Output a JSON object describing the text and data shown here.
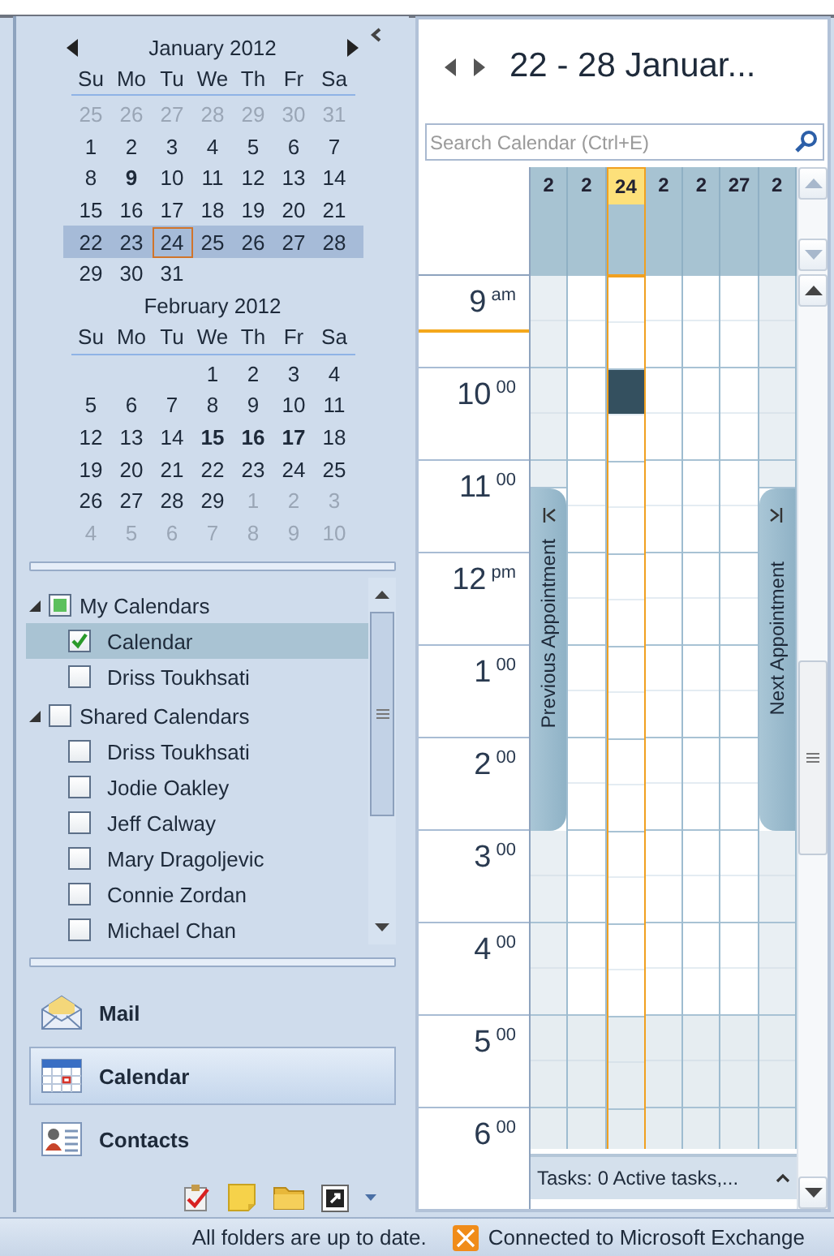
{
  "months": [
    {
      "title": "January 2012",
      "weekdays": [
        "Su",
        "Mo",
        "Tu",
        "We",
        "Th",
        "Fr",
        "Sa"
      ],
      "weeks": [
        {
          "selected": false,
          "days": [
            {
              "text": "25",
              "kind": "other"
            },
            {
              "text": "26",
              "kind": "other"
            },
            {
              "text": "27",
              "kind": "other"
            },
            {
              "text": "28",
              "kind": "other"
            },
            {
              "text": "29",
              "kind": "other"
            },
            {
              "text": "30",
              "kind": "other"
            },
            {
              "text": "31",
              "kind": "other"
            }
          ]
        },
        {
          "selected": false,
          "days": [
            {
              "text": "1",
              "kind": "day"
            },
            {
              "text": "2",
              "kind": "day"
            },
            {
              "text": "3",
              "kind": "day"
            },
            {
              "text": "4",
              "kind": "day"
            },
            {
              "text": "5",
              "kind": "day"
            },
            {
              "text": "6",
              "kind": "day"
            },
            {
              "text": "7",
              "kind": "day"
            }
          ]
        },
        {
          "selected": false,
          "days": [
            {
              "text": "8",
              "kind": "day"
            },
            {
              "text": "9",
              "kind": "busy"
            },
            {
              "text": "10",
              "kind": "day"
            },
            {
              "text": "11",
              "kind": "day"
            },
            {
              "text": "12",
              "kind": "day"
            },
            {
              "text": "13",
              "kind": "day"
            },
            {
              "text": "14",
              "kind": "day"
            }
          ]
        },
        {
          "selected": false,
          "days": [
            {
              "text": "15",
              "kind": "day"
            },
            {
              "text": "16",
              "kind": "day"
            },
            {
              "text": "17",
              "kind": "day"
            },
            {
              "text": "18",
              "kind": "day"
            },
            {
              "text": "19",
              "kind": "day"
            },
            {
              "text": "20",
              "kind": "day"
            },
            {
              "text": "21",
              "kind": "day"
            }
          ]
        },
        {
          "selected": true,
          "days": [
            {
              "text": "22",
              "kind": "day"
            },
            {
              "text": "23",
              "kind": "day"
            },
            {
              "text": "24",
              "kind": "today"
            },
            {
              "text": "25",
              "kind": "day"
            },
            {
              "text": "26",
              "kind": "day"
            },
            {
              "text": "27",
              "kind": "day"
            },
            {
              "text": "28",
              "kind": "day"
            }
          ]
        },
        {
          "selected": false,
          "days": [
            {
              "text": "29",
              "kind": "day"
            },
            {
              "text": "30",
              "kind": "day"
            },
            {
              "text": "31",
              "kind": "day"
            }
          ]
        }
      ]
    },
    {
      "title": "February 2012",
      "weekdays": [
        "Su",
        "Mo",
        "Tu",
        "We",
        "Th",
        "Fr",
        "Sa"
      ],
      "weeks": [
        {
          "selected": false,
          "days": [
            {
              "kind": "blank"
            },
            {
              "kind": "blank"
            },
            {
              "kind": "blank"
            },
            {
              "text": "1",
              "kind": "day"
            },
            {
              "text": "2",
              "kind": "day"
            },
            {
              "text": "3",
              "kind": "day"
            },
            {
              "text": "4",
              "kind": "day"
            }
          ]
        },
        {
          "selected": false,
          "days": [
            {
              "text": "5",
              "kind": "day"
            },
            {
              "text": "6",
              "kind": "day"
            },
            {
              "text": "7",
              "kind": "day"
            },
            {
              "text": "8",
              "kind": "day"
            },
            {
              "text": "9",
              "kind": "day"
            },
            {
              "text": "10",
              "kind": "day"
            },
            {
              "text": "11",
              "kind": "day"
            }
          ]
        },
        {
          "selected": false,
          "days": [
            {
              "text": "12",
              "kind": "day"
            },
            {
              "text": "13",
              "kind": "day"
            },
            {
              "text": "14",
              "kind": "day"
            },
            {
              "text": "15",
              "kind": "busy"
            },
            {
              "text": "16",
              "kind": "busy"
            },
            {
              "text": "17",
              "kind": "busy"
            },
            {
              "text": "18",
              "kind": "day"
            }
          ]
        },
        {
          "selected": false,
          "days": [
            {
              "text": "19",
              "kind": "day"
            },
            {
              "text": "20",
              "kind": "day"
            },
            {
              "text": "21",
              "kind": "day"
            },
            {
              "text": "22",
              "kind": "day"
            },
            {
              "text": "23",
              "kind": "day"
            },
            {
              "text": "24",
              "kind": "day"
            },
            {
              "text": "25",
              "kind": "day"
            }
          ]
        },
        {
          "selected": false,
          "days": [
            {
              "text": "26",
              "kind": "day"
            },
            {
              "text": "27",
              "kind": "day"
            },
            {
              "text": "28",
              "kind": "day"
            },
            {
              "text": "29",
              "kind": "day"
            },
            {
              "text": "1",
              "kind": "other"
            },
            {
              "text": "2",
              "kind": "other"
            },
            {
              "text": "3",
              "kind": "other"
            }
          ]
        },
        {
          "selected": false,
          "days": [
            {
              "text": "4",
              "kind": "other"
            },
            {
              "text": "5",
              "kind": "other"
            },
            {
              "text": "6",
              "kind": "other"
            },
            {
              "text": "7",
              "kind": "other"
            },
            {
              "text": "8",
              "kind": "other"
            },
            {
              "text": "9",
              "kind": "other"
            },
            {
              "text": "10",
              "kind": "other"
            }
          ]
        }
      ]
    }
  ],
  "calendar_list": [
    {
      "label": "My Calendars",
      "expanded": true,
      "partial": true,
      "items": [
        {
          "label": "Calendar",
          "checked": true,
          "selected": true
        },
        {
          "label": "Driss Toukhsati",
          "checked": false,
          "selected": false
        }
      ]
    },
    {
      "label": "Shared Calendars",
      "expanded": true,
      "partial": false,
      "items": [
        {
          "label": "Driss Toukhsati",
          "checked": false,
          "selected": false
        },
        {
          "label": "Jodie Oakley",
          "checked": false,
          "selected": false
        },
        {
          "label": "Jeff Calway",
          "checked": false,
          "selected": false
        },
        {
          "label": "Mary Dragoljevic",
          "checked": false,
          "selected": false
        },
        {
          "label": "Connie Zordan",
          "checked": false,
          "selected": false
        },
        {
          "label": "Michael Chan",
          "checked": false,
          "selected": false
        }
      ]
    }
  ],
  "nav_buttons": [
    {
      "label": "Mail",
      "kind": "mail",
      "selected": false
    },
    {
      "label": "Calendar",
      "kind": "calendar",
      "selected": true
    },
    {
      "label": "Contacts",
      "kind": "contacts",
      "selected": false
    }
  ],
  "calendar_view": {
    "title": "22 - 28 Januar...",
    "search": {
      "placeholder": "Search Calendar (Ctrl+E)"
    },
    "days": [
      {
        "label": "2",
        "weekend": true,
        "selected": false
      },
      {
        "label": "2",
        "weekend": false,
        "selected": false
      },
      {
        "label": "24",
        "weekend": false,
        "selected": true
      },
      {
        "label": "2",
        "weekend": false,
        "selected": false
      },
      {
        "label": "2",
        "weekend": false,
        "selected": false
      },
      {
        "label": "27",
        "weekend": false,
        "selected": false
      },
      {
        "label": "2",
        "weekend": true,
        "selected": false
      }
    ],
    "hours": [
      {
        "hour": "9",
        "suffix": "am",
        "work": true,
        "current": true,
        "appointment": false
      },
      {
        "hour": "10",
        "suffix": "00",
        "work": true,
        "current": false,
        "appointment": true
      },
      {
        "hour": "11",
        "suffix": "00",
        "work": true,
        "current": false,
        "appointment": false
      },
      {
        "hour": "12",
        "suffix": "pm",
        "work": true,
        "current": false,
        "appointment": false
      },
      {
        "hour": "1",
        "suffix": "00",
        "work": true,
        "current": false,
        "appointment": false
      },
      {
        "hour": "2",
        "suffix": "00",
        "work": true,
        "current": false,
        "appointment": false
      },
      {
        "hour": "3",
        "suffix": "00",
        "work": true,
        "current": false,
        "appointment": false
      },
      {
        "hour": "4",
        "suffix": "00",
        "work": true,
        "current": false,
        "appointment": false
      },
      {
        "hour": "5",
        "suffix": "00",
        "work": false,
        "current": false,
        "appointment": false
      },
      {
        "hour": "6",
        "suffix": "00",
        "work": false,
        "current": false,
        "appointment": false
      }
    ],
    "side_tabs": [
      {
        "label": "Previous Appointment",
        "kind": "previous"
      },
      {
        "label": "Next Appointment",
        "kind": "next"
      }
    ],
    "tasks_bar": "Tasks: 0 Active tasks,..."
  },
  "status_bar": {
    "sync": "All folders are up to date.",
    "connection": "Connected to Microsoft Exchange"
  }
}
